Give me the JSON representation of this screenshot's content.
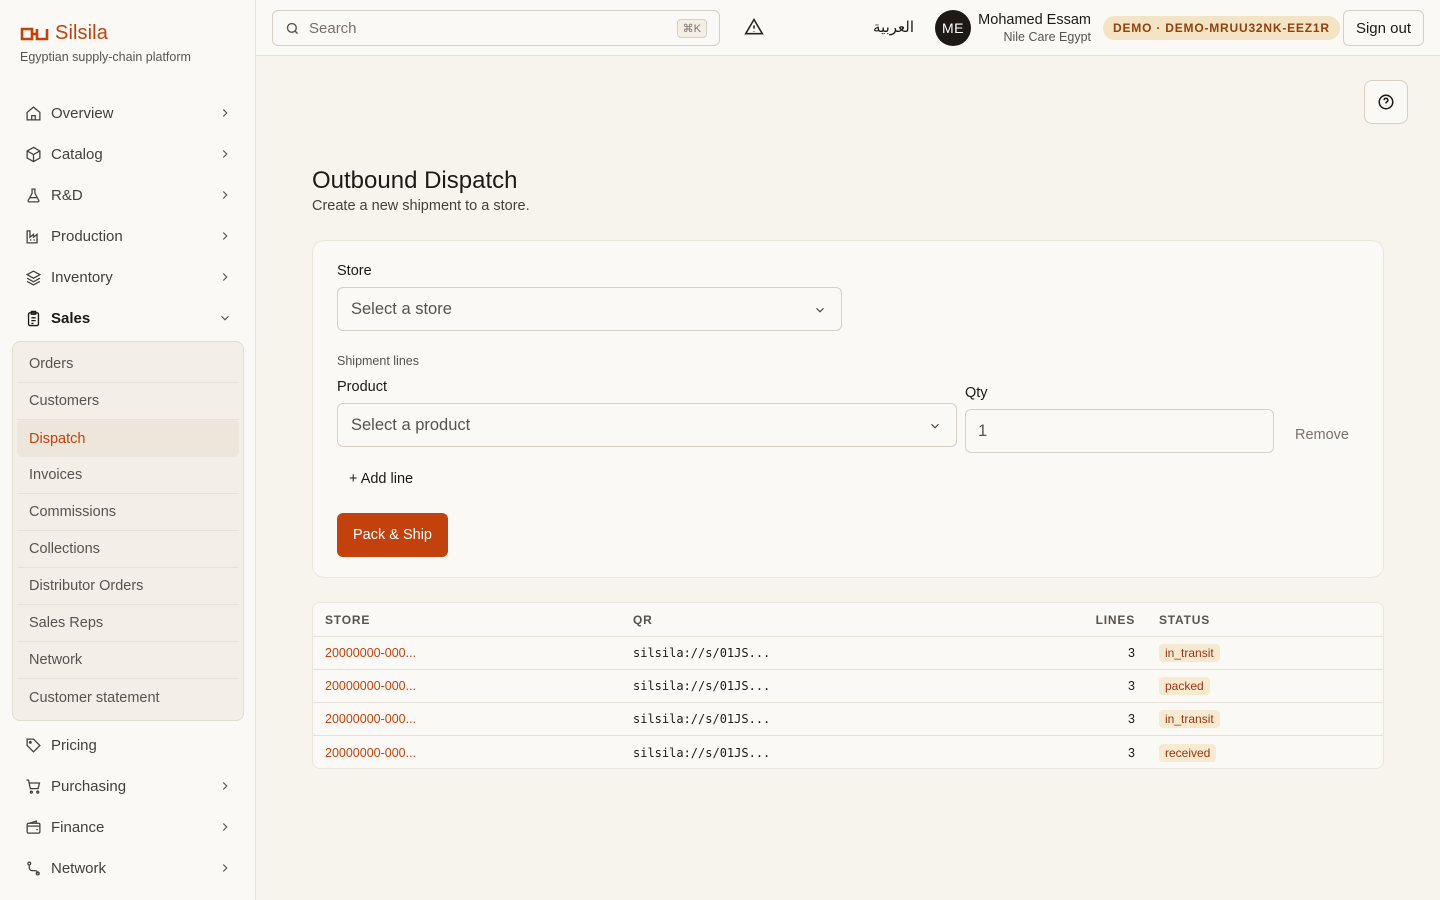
{
  "brand": {
    "name": "Silsila",
    "tagline": "Egyptian supply-chain platform",
    "accent": "#c2410c"
  },
  "sidebar": {
    "items_top": [
      {
        "label": "Overview",
        "icon": "home-icon"
      },
      {
        "label": "Catalog",
        "icon": "box-icon"
      },
      {
        "label": "R&D",
        "icon": "flask-icon"
      },
      {
        "label": "Production",
        "icon": "factory-icon"
      },
      {
        "label": "Inventory",
        "icon": "layers-icon"
      },
      {
        "label": "Sales",
        "icon": "clipboard-icon"
      }
    ],
    "sales_sub": [
      "Orders",
      "Customers",
      "Dispatch",
      "Invoices",
      "Commissions",
      "Collections",
      "Distributor Orders",
      "Sales Reps",
      "Network",
      "Customer statement"
    ],
    "items_bottom": [
      {
        "label": "Pricing",
        "icon": "tag-icon"
      },
      {
        "label": "Purchasing",
        "icon": "cart-icon"
      },
      {
        "label": "Finance",
        "icon": "wallet-icon"
      },
      {
        "label": "Network",
        "icon": "route-icon"
      }
    ]
  },
  "topbar": {
    "search_placeholder": "Search",
    "search_shortcut": "⌘K",
    "language": "العربية",
    "avatar_initials": "ME",
    "user_name": "Mohamed Essam",
    "user_org": "Nile Care Egypt",
    "demo_badge": "DEMO · DEMO-MRUU32NK-EEZ1R",
    "sign_out": "Sign out"
  },
  "page": {
    "title": "Outbound Dispatch",
    "subtitle": "Create a new shipment to a store."
  },
  "form": {
    "store_label": "Store",
    "store_placeholder": "Select a store",
    "lines_label": "Shipment lines",
    "product_label": "Product",
    "product_placeholder": "Select a product",
    "qty_label": "Qty",
    "qty_value": "1",
    "remove_label": "Remove",
    "add_line_label": "+ Add line",
    "submit_label": "Pack & Ship"
  },
  "table": {
    "headers": {
      "store": "STORE",
      "qr": "QR",
      "lines": "LINES",
      "status": "STATUS"
    },
    "rows": [
      {
        "store": "20000000-000...",
        "qr": "silsila://s/01JS...",
        "lines": "3",
        "status": "in_transit"
      },
      {
        "store": "20000000-000...",
        "qr": "silsila://s/01JS...",
        "lines": "3",
        "status": "packed"
      },
      {
        "store": "20000000-000...",
        "qr": "silsila://s/01JS...",
        "lines": "3",
        "status": "in_transit"
      },
      {
        "store": "20000000-000...",
        "qr": "silsila://s/01JS...",
        "lines": "3",
        "status": "received"
      }
    ]
  }
}
